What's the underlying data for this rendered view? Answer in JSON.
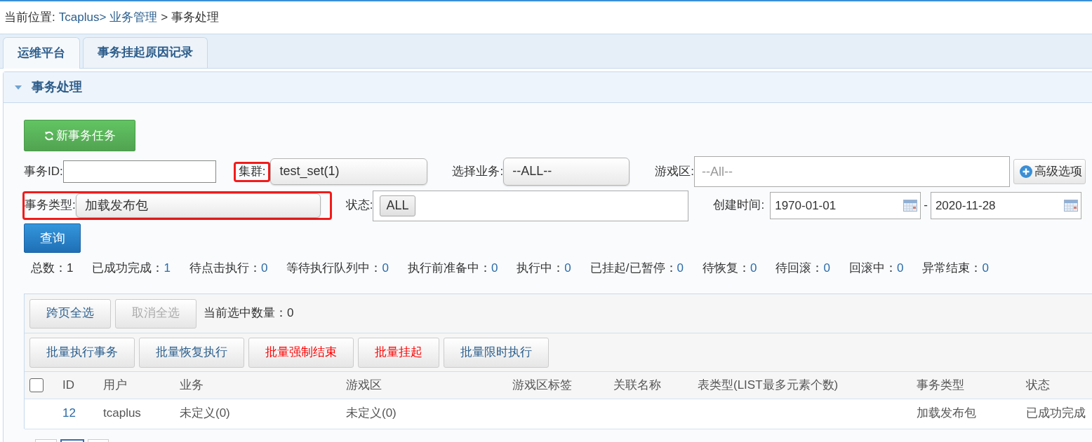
{
  "breadcrumb": {
    "label": "当前位置:",
    "items": [
      {
        "text": "Tcaplus>",
        "kind": "link"
      },
      {
        "text": "业务管理",
        "kind": "link"
      },
      {
        "text": ">",
        "kind": "separator"
      },
      {
        "text": "事务处理",
        "kind": "current"
      }
    ]
  },
  "tabs": [
    {
      "label": "运维平台",
      "selected": true
    },
    {
      "label": "事务挂起原因记录",
      "selected": false
    }
  ],
  "panel": {
    "title": "事务处理",
    "expanded": true
  },
  "new_task_button": {
    "label": "新事务任务"
  },
  "filter_rows": [
    [
      {
        "kind": "text",
        "label": "事务ID:",
        "label_highlighted": false,
        "highlighted": false
      },
      {
        "kind": "select",
        "label": "集群:",
        "value": "test_set(1)",
        "label_highlighted": true,
        "highlighted": false
      },
      {
        "kind": "select",
        "label": "选择业务:",
        "value": "--ALL--",
        "label_highlighted": false,
        "highlighted": false
      },
      {
        "kind": "multiselect",
        "label": "游戏区:",
        "placeholder": "--All--",
        "label_highlighted": false,
        "highlighted": false
      },
      {
        "kind": "button",
        "label": "高级选项",
        "label_highlighted": false,
        "highlighted": false
      }
    ],
    [
      {
        "kind": "select",
        "label": "事务类型:",
        "value": "加载发布包",
        "label_highlighted": false,
        "highlighted": true
      },
      {
        "kind": "tags",
        "label": "状态:",
        "tags": [
          "ALL"
        ],
        "label_highlighted": false,
        "highlighted": false
      },
      {
        "kind": "daterange",
        "label": "创建时间:",
        "from": "1970-01-01",
        "separator": "-",
        "to": "2020-11-28",
        "label_highlighted": false,
        "highlighted": false
      }
    ]
  ],
  "query_button": {
    "label": "查询"
  },
  "stats": [
    {
      "label": "总数：",
      "value": "1",
      "kind": "total"
    },
    {
      "label": "已成功完成：",
      "value": "1",
      "kind": "count"
    },
    {
      "label": "待点击执行：",
      "value": "0",
      "kind": "count"
    },
    {
      "label": "等待执行队列中：",
      "value": "0",
      "kind": "count"
    },
    {
      "label": "执行前准备中：",
      "value": "0",
      "kind": "count"
    },
    {
      "label": "执行中：",
      "value": "0",
      "kind": "count"
    },
    {
      "label": "已挂起/已暂停：",
      "value": "0",
      "kind": "count"
    },
    {
      "label": "待恢复：",
      "value": "0",
      "kind": "count"
    },
    {
      "label": "待回滚：",
      "value": "0",
      "kind": "count"
    },
    {
      "label": "回滚中：",
      "value": "0",
      "kind": "count"
    },
    {
      "label": "异常结束：",
      "value": "0",
      "kind": "count"
    }
  ],
  "selection_bar": {
    "buttons": [
      {
        "label": "跨页全选",
        "disabled": false
      },
      {
        "label": "取消全选",
        "disabled": true
      }
    ],
    "selected_count": "当前选中数量：0"
  },
  "batch_buttons": [
    {
      "label": "批量执行事务",
      "kind": "normal"
    },
    {
      "label": "批量恢复执行",
      "kind": "normal"
    },
    {
      "label": "批量强制结束",
      "kind": "danger"
    },
    {
      "label": "批量挂起",
      "kind": "danger"
    },
    {
      "label": "批量限时执行",
      "kind": "normal"
    }
  ],
  "table": {
    "select_all": {
      "checked": false
    },
    "columns": [
      "ID",
      "用户",
      "业务",
      "游戏区",
      "游戏区标签",
      "关联名称",
      "表类型(LIST最多元素个数)",
      "事务类型",
      "状态"
    ],
    "rows": [
      {
        "cells": [
          "12",
          "tcaplus",
          "未定义(0)",
          "未定义(0)",
          null,
          null,
          null,
          "加载发布包",
          "已成功完成"
        ]
      }
    ]
  },
  "pagination": [
    {
      "selected": false
    },
    {
      "selected": true
    },
    {
      "selected": false
    }
  ]
}
